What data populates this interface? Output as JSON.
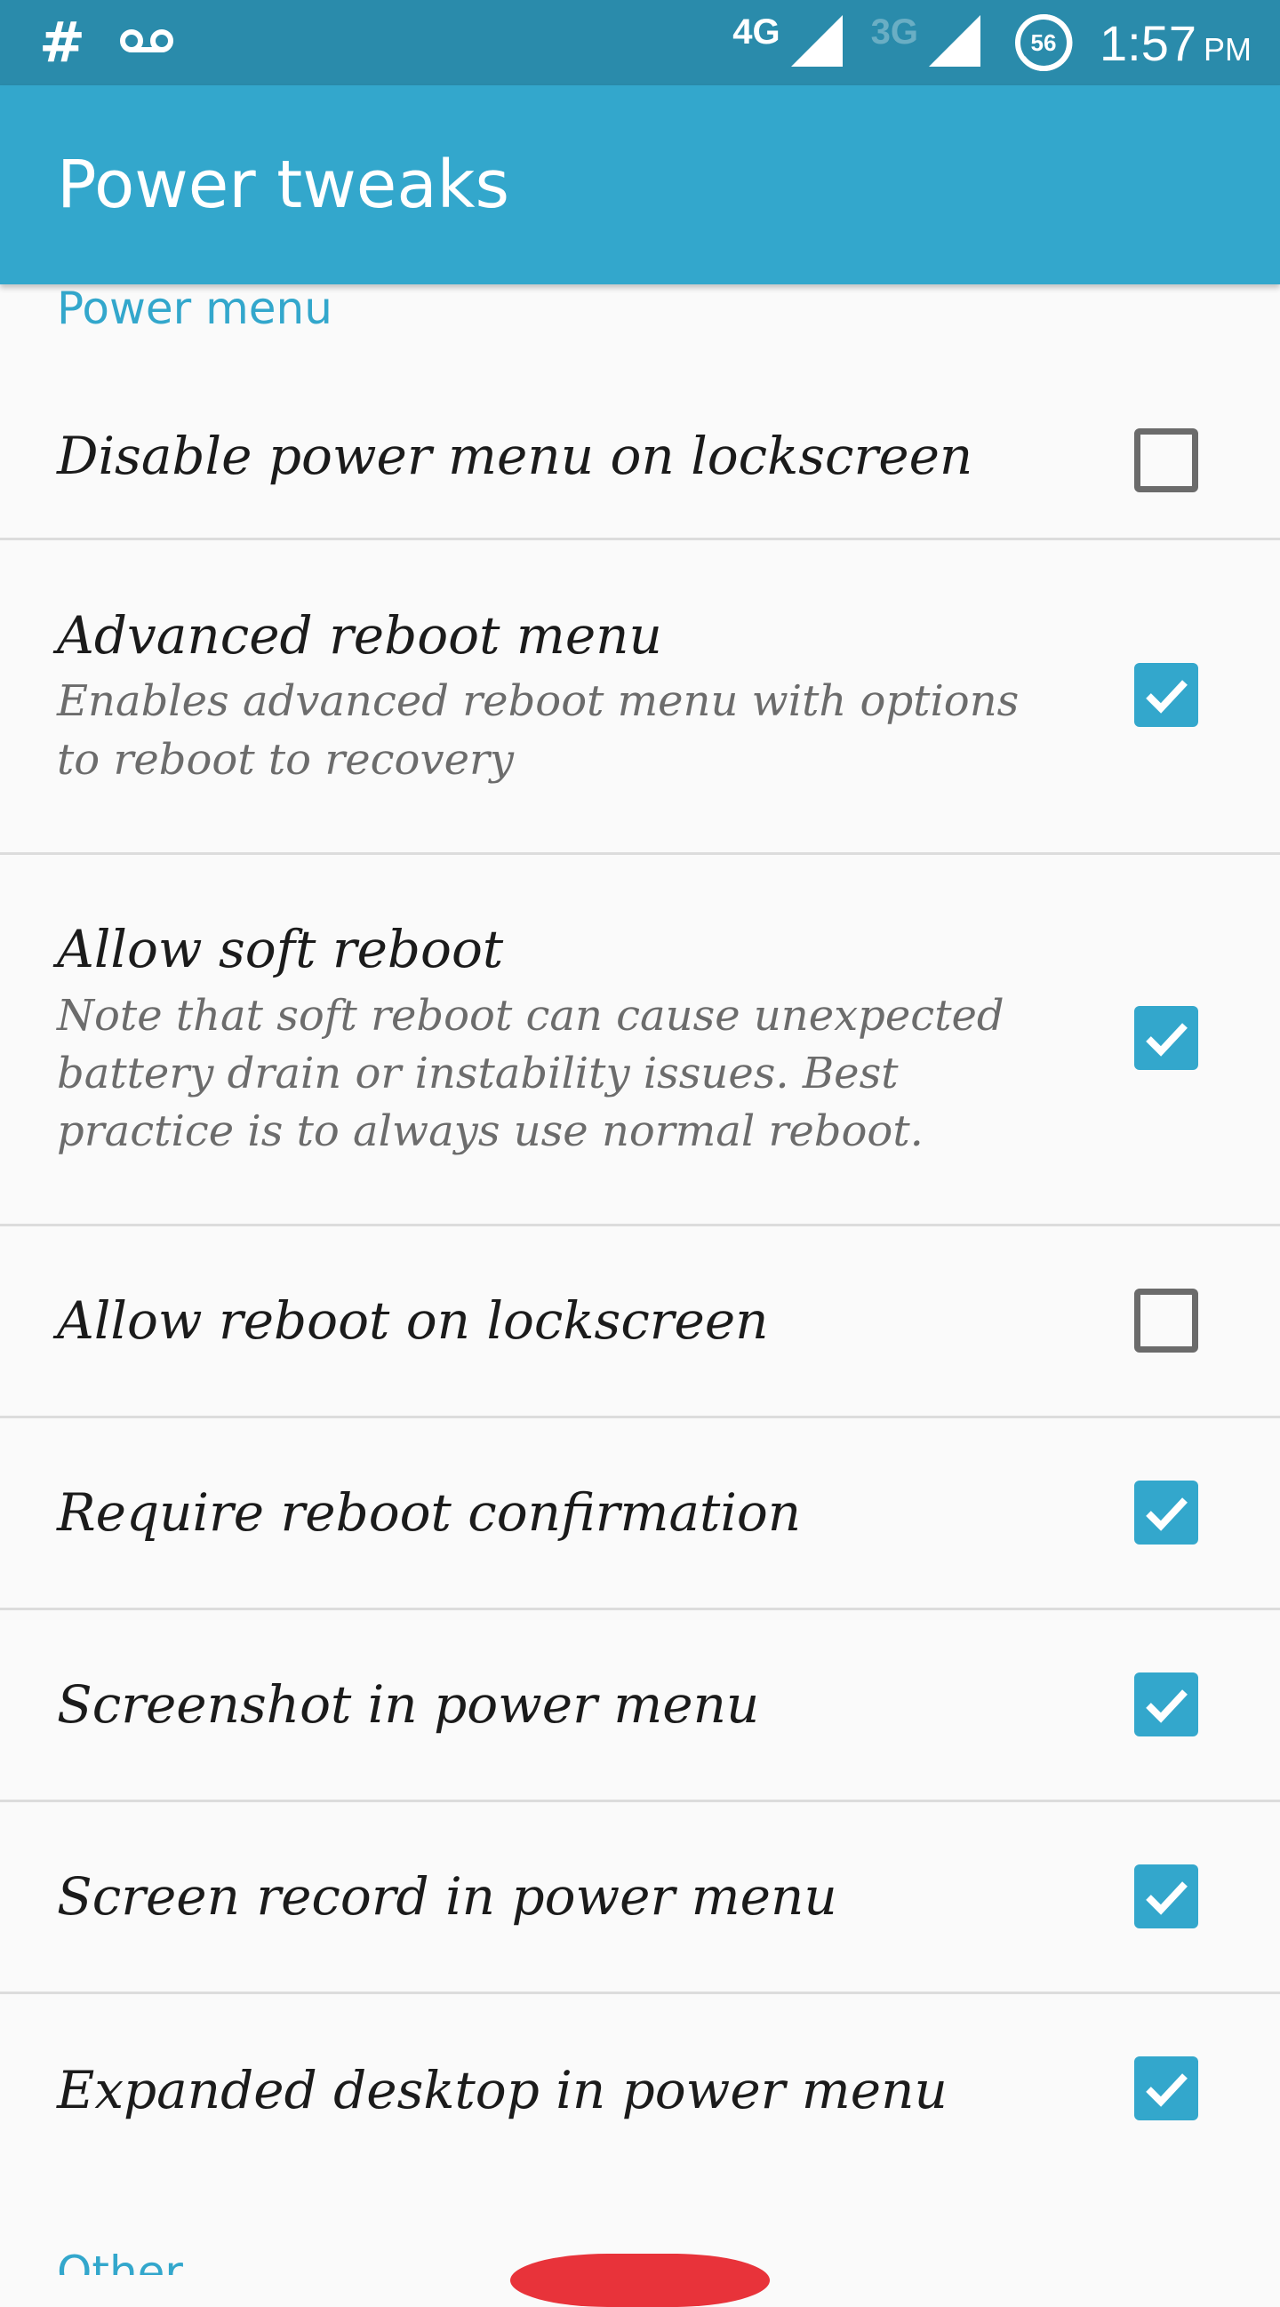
{
  "status_bar": {
    "left_icons": [
      "hash-icon",
      "voicemail-icon"
    ],
    "hash_symbol": "#",
    "network_primary": "4G",
    "network_secondary": "3G",
    "battery_level": "56",
    "time": "1:57",
    "ampm": "PM",
    "accent_color": "#2a8bab"
  },
  "app_bar": {
    "title": "Power tweaks",
    "color": "#33a7cc"
  },
  "sections": [
    {
      "header": "Power menu",
      "items": [
        {
          "title": "Disable power menu on lockscreen",
          "summary": "",
          "checked": false
        },
        {
          "title": "Advanced reboot menu",
          "summary": "Enables advanced reboot menu with options to reboot to recovery",
          "checked": true
        },
        {
          "title": "Allow soft reboot",
          "summary": "Note that soft reboot can cause unexpected battery drain or instability issues. Best practice is to always use normal reboot.",
          "checked": true
        },
        {
          "title": "Allow reboot on lockscreen",
          "summary": "",
          "checked": false
        },
        {
          "title": "Require reboot confirmation",
          "summary": "",
          "checked": true
        },
        {
          "title": "Screenshot in power menu",
          "summary": "",
          "checked": true
        },
        {
          "title": "Screen record in power menu",
          "summary": "",
          "checked": true
        },
        {
          "title": "Expanded desktop in power menu",
          "summary": "",
          "checked": true
        }
      ]
    },
    {
      "header": "Other",
      "items": []
    }
  ],
  "colors": {
    "accent": "#33a7cc",
    "checkbox_on": "#33a7cc",
    "checkbox_off_border": "#6b6b6b",
    "fab": "#e8333a"
  }
}
